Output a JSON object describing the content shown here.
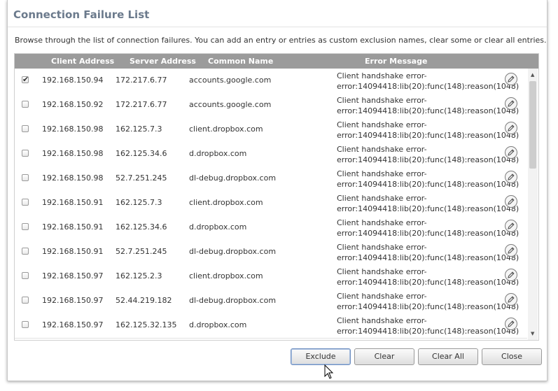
{
  "dialog": {
    "title": "Connection Failure List",
    "description": "Browse through the list of connection failures. You can add an entry or entries as custom exclusion names, clear some or clear all entries."
  },
  "table": {
    "columns": [
      "Client Address",
      "Server Address",
      "Common Name",
      "Error Message"
    ],
    "error_line1": "Client handshake error-",
    "error_line2": "error:14094418:lib(20):func(148):reason(1048)",
    "rows": [
      {
        "checked": true,
        "client": "192.168.150.94",
        "server": "172.217.6.77",
        "common_name": "accounts.google.com"
      },
      {
        "checked": false,
        "client": "192.168.150.92",
        "server": "172.217.6.77",
        "common_name": "accounts.google.com"
      },
      {
        "checked": false,
        "client": "192.168.150.98",
        "server": "162.125.7.3",
        "common_name": "client.dropbox.com"
      },
      {
        "checked": false,
        "client": "192.168.150.98",
        "server": "162.125.34.6",
        "common_name": "d.dropbox.com"
      },
      {
        "checked": false,
        "client": "192.168.150.98",
        "server": "52.7.251.245",
        "common_name": "dl-debug.dropbox.com"
      },
      {
        "checked": false,
        "client": "192.168.150.91",
        "server": "162.125.7.3",
        "common_name": "client.dropbox.com"
      },
      {
        "checked": false,
        "client": "192.168.150.91",
        "server": "162.125.34.6",
        "common_name": "d.dropbox.com"
      },
      {
        "checked": false,
        "client": "192.168.150.91",
        "server": "52.7.251.245",
        "common_name": "dl-debug.dropbox.com"
      },
      {
        "checked": false,
        "client": "192.168.150.97",
        "server": "162.125.2.3",
        "common_name": "client.dropbox.com"
      },
      {
        "checked": false,
        "client": "192.168.150.97",
        "server": "52.44.219.182",
        "common_name": "dl-debug.dropbox.com"
      },
      {
        "checked": false,
        "client": "192.168.150.97",
        "server": "162.125.32.135",
        "common_name": "d.dropbox.com"
      }
    ]
  },
  "buttons": {
    "exclude": "Exclude",
    "clear": "Clear",
    "clear_all": "Clear All",
    "close": "Close"
  },
  "icons": {
    "row_action": "pencil-icon",
    "checkmark": "✔",
    "scroll_up": "▲",
    "scroll_down": "▼"
  },
  "colors": {
    "title": "#6b7a8c",
    "header_bg": "#9b9b9b",
    "focus_border": "#6f8fc0"
  }
}
